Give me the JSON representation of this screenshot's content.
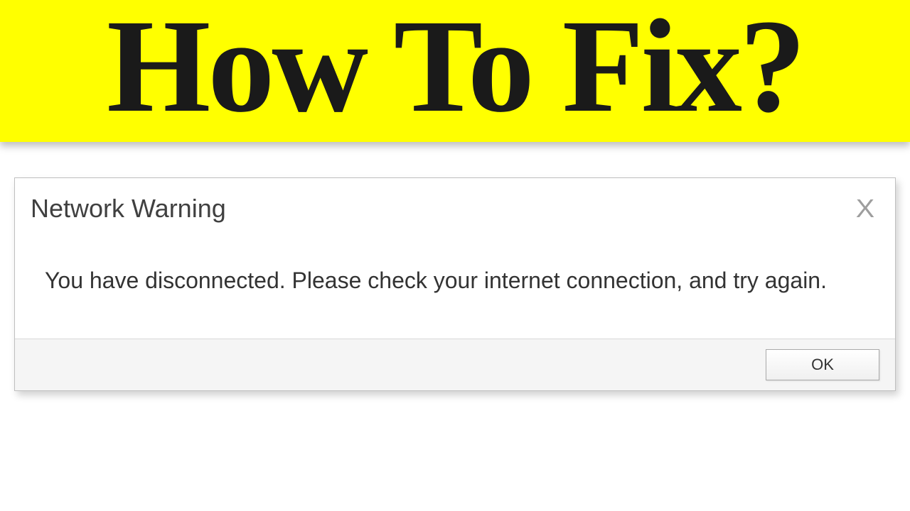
{
  "banner": {
    "text": "How To Fix?"
  },
  "dialog": {
    "title": "Network Warning",
    "close": "X",
    "message": "You have disconnected. Please check your internet connection, and try again.",
    "ok": "OK"
  }
}
